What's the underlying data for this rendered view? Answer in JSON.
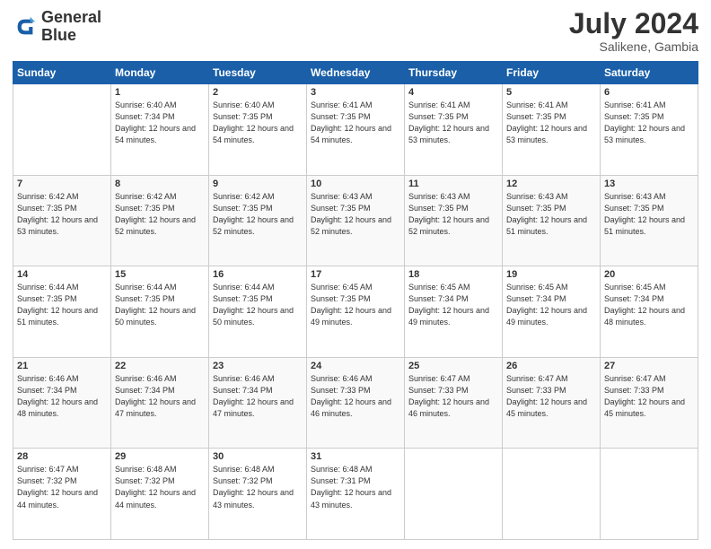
{
  "logo": {
    "line1": "General",
    "line2": "Blue"
  },
  "title": "July 2024",
  "location": "Salikene, Gambia",
  "days_of_week": [
    "Sunday",
    "Monday",
    "Tuesday",
    "Wednesday",
    "Thursday",
    "Friday",
    "Saturday"
  ],
  "weeks": [
    [
      {
        "day": "",
        "sunrise": "",
        "sunset": "",
        "daylight": ""
      },
      {
        "day": "1",
        "sunrise": "Sunrise: 6:40 AM",
        "sunset": "Sunset: 7:34 PM",
        "daylight": "Daylight: 12 hours and 54 minutes."
      },
      {
        "day": "2",
        "sunrise": "Sunrise: 6:40 AM",
        "sunset": "Sunset: 7:35 PM",
        "daylight": "Daylight: 12 hours and 54 minutes."
      },
      {
        "day": "3",
        "sunrise": "Sunrise: 6:41 AM",
        "sunset": "Sunset: 7:35 PM",
        "daylight": "Daylight: 12 hours and 54 minutes."
      },
      {
        "day": "4",
        "sunrise": "Sunrise: 6:41 AM",
        "sunset": "Sunset: 7:35 PM",
        "daylight": "Daylight: 12 hours and 53 minutes."
      },
      {
        "day": "5",
        "sunrise": "Sunrise: 6:41 AM",
        "sunset": "Sunset: 7:35 PM",
        "daylight": "Daylight: 12 hours and 53 minutes."
      },
      {
        "day": "6",
        "sunrise": "Sunrise: 6:41 AM",
        "sunset": "Sunset: 7:35 PM",
        "daylight": "Daylight: 12 hours and 53 minutes."
      }
    ],
    [
      {
        "day": "7",
        "sunrise": "Sunrise: 6:42 AM",
        "sunset": "Sunset: 7:35 PM",
        "daylight": "Daylight: 12 hours and 53 minutes."
      },
      {
        "day": "8",
        "sunrise": "Sunrise: 6:42 AM",
        "sunset": "Sunset: 7:35 PM",
        "daylight": "Daylight: 12 hours and 52 minutes."
      },
      {
        "day": "9",
        "sunrise": "Sunrise: 6:42 AM",
        "sunset": "Sunset: 7:35 PM",
        "daylight": "Daylight: 12 hours and 52 minutes."
      },
      {
        "day": "10",
        "sunrise": "Sunrise: 6:43 AM",
        "sunset": "Sunset: 7:35 PM",
        "daylight": "Daylight: 12 hours and 52 minutes."
      },
      {
        "day": "11",
        "sunrise": "Sunrise: 6:43 AM",
        "sunset": "Sunset: 7:35 PM",
        "daylight": "Daylight: 12 hours and 52 minutes."
      },
      {
        "day": "12",
        "sunrise": "Sunrise: 6:43 AM",
        "sunset": "Sunset: 7:35 PM",
        "daylight": "Daylight: 12 hours and 51 minutes."
      },
      {
        "day": "13",
        "sunrise": "Sunrise: 6:43 AM",
        "sunset": "Sunset: 7:35 PM",
        "daylight": "Daylight: 12 hours and 51 minutes."
      }
    ],
    [
      {
        "day": "14",
        "sunrise": "Sunrise: 6:44 AM",
        "sunset": "Sunset: 7:35 PM",
        "daylight": "Daylight: 12 hours and 51 minutes."
      },
      {
        "day": "15",
        "sunrise": "Sunrise: 6:44 AM",
        "sunset": "Sunset: 7:35 PM",
        "daylight": "Daylight: 12 hours and 50 minutes."
      },
      {
        "day": "16",
        "sunrise": "Sunrise: 6:44 AM",
        "sunset": "Sunset: 7:35 PM",
        "daylight": "Daylight: 12 hours and 50 minutes."
      },
      {
        "day": "17",
        "sunrise": "Sunrise: 6:45 AM",
        "sunset": "Sunset: 7:35 PM",
        "daylight": "Daylight: 12 hours and 49 minutes."
      },
      {
        "day": "18",
        "sunrise": "Sunrise: 6:45 AM",
        "sunset": "Sunset: 7:34 PM",
        "daylight": "Daylight: 12 hours and 49 minutes."
      },
      {
        "day": "19",
        "sunrise": "Sunrise: 6:45 AM",
        "sunset": "Sunset: 7:34 PM",
        "daylight": "Daylight: 12 hours and 49 minutes."
      },
      {
        "day": "20",
        "sunrise": "Sunrise: 6:45 AM",
        "sunset": "Sunset: 7:34 PM",
        "daylight": "Daylight: 12 hours and 48 minutes."
      }
    ],
    [
      {
        "day": "21",
        "sunrise": "Sunrise: 6:46 AM",
        "sunset": "Sunset: 7:34 PM",
        "daylight": "Daylight: 12 hours and 48 minutes."
      },
      {
        "day": "22",
        "sunrise": "Sunrise: 6:46 AM",
        "sunset": "Sunset: 7:34 PM",
        "daylight": "Daylight: 12 hours and 47 minutes."
      },
      {
        "day": "23",
        "sunrise": "Sunrise: 6:46 AM",
        "sunset": "Sunset: 7:34 PM",
        "daylight": "Daylight: 12 hours and 47 minutes."
      },
      {
        "day": "24",
        "sunrise": "Sunrise: 6:46 AM",
        "sunset": "Sunset: 7:33 PM",
        "daylight": "Daylight: 12 hours and 46 minutes."
      },
      {
        "day": "25",
        "sunrise": "Sunrise: 6:47 AM",
        "sunset": "Sunset: 7:33 PM",
        "daylight": "Daylight: 12 hours and 46 minutes."
      },
      {
        "day": "26",
        "sunrise": "Sunrise: 6:47 AM",
        "sunset": "Sunset: 7:33 PM",
        "daylight": "Daylight: 12 hours and 45 minutes."
      },
      {
        "day": "27",
        "sunrise": "Sunrise: 6:47 AM",
        "sunset": "Sunset: 7:33 PM",
        "daylight": "Daylight: 12 hours and 45 minutes."
      }
    ],
    [
      {
        "day": "28",
        "sunrise": "Sunrise: 6:47 AM",
        "sunset": "Sunset: 7:32 PM",
        "daylight": "Daylight: 12 hours and 44 minutes."
      },
      {
        "day": "29",
        "sunrise": "Sunrise: 6:48 AM",
        "sunset": "Sunset: 7:32 PM",
        "daylight": "Daylight: 12 hours and 44 minutes."
      },
      {
        "day": "30",
        "sunrise": "Sunrise: 6:48 AM",
        "sunset": "Sunset: 7:32 PM",
        "daylight": "Daylight: 12 hours and 43 minutes."
      },
      {
        "day": "31",
        "sunrise": "Sunrise: 6:48 AM",
        "sunset": "Sunset: 7:31 PM",
        "daylight": "Daylight: 12 hours and 43 minutes."
      },
      {
        "day": "",
        "sunrise": "",
        "sunset": "",
        "daylight": ""
      },
      {
        "day": "",
        "sunrise": "",
        "sunset": "",
        "daylight": ""
      },
      {
        "day": "",
        "sunrise": "",
        "sunset": "",
        "daylight": ""
      }
    ]
  ]
}
